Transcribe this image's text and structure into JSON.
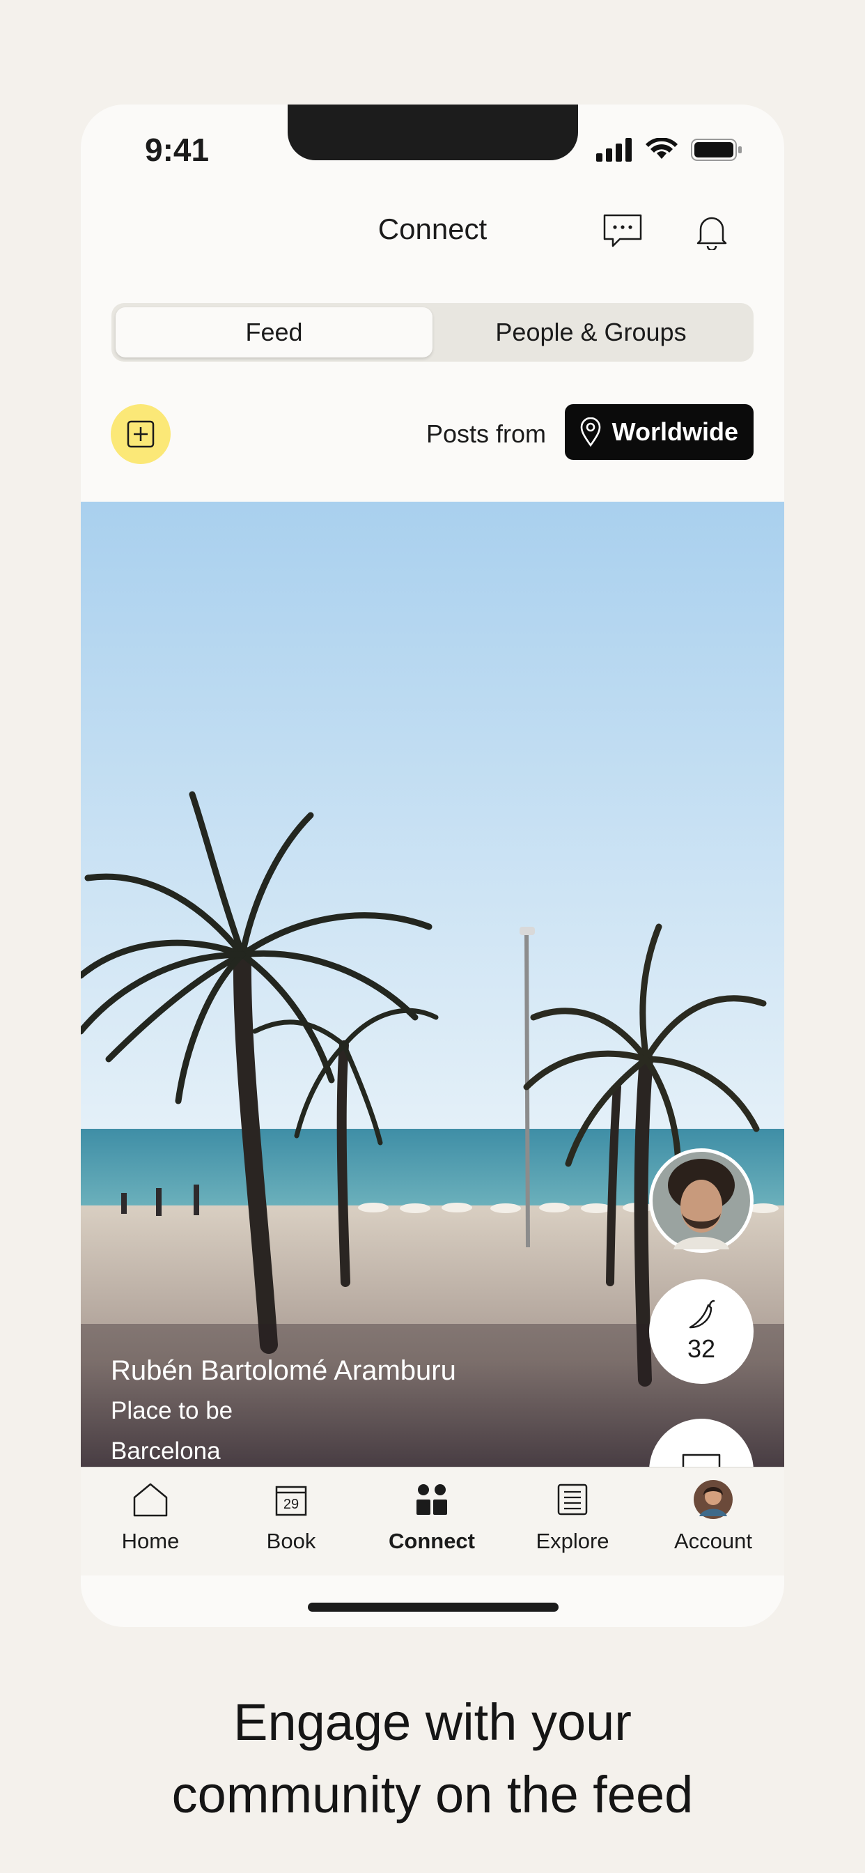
{
  "status_bar": {
    "time": "9:41"
  },
  "header": {
    "title": "Connect",
    "messages_icon": "chat-bubble-icon",
    "notifications_icon": "bell-icon"
  },
  "tabs": [
    {
      "label": "Feed",
      "active": true
    },
    {
      "label": "People & Groups",
      "active": false
    }
  ],
  "filter": {
    "add_icon": "plus-square-icon",
    "posts_from_label": "Posts from",
    "location_label": "Worldwide",
    "location_icon": "map-pin-icon"
  },
  "post": {
    "author": "Rubén Bartolomé Aramburu",
    "title": "Place to be",
    "location": "Barcelona",
    "like_count": "32",
    "like_icon": "chili-pepper-icon",
    "comment_icon": "comment-icon"
  },
  "nav": [
    {
      "label": "Home",
      "icon": "home-icon",
      "active": false
    },
    {
      "label": "Book",
      "icon": "calendar-icon",
      "calendar_day": "29",
      "active": false
    },
    {
      "label": "Connect",
      "icon": "people-icon",
      "active": true
    },
    {
      "label": "Explore",
      "icon": "document-icon",
      "active": false
    },
    {
      "label": "Account",
      "icon": "avatar",
      "active": false
    }
  ],
  "caption": {
    "line1": "Engage with your",
    "line2": "community on the feed"
  },
  "colors": {
    "background": "#f4f1ec",
    "phone": "#fbfaf8",
    "accent_yellow": "#fbe877",
    "dark": "#0b0b0b"
  }
}
